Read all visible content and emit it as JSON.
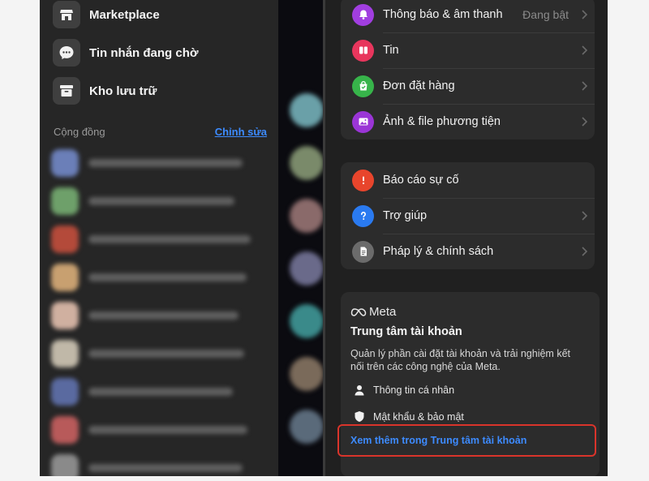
{
  "left_menu": {
    "items": [
      {
        "label": "Marketplace",
        "icon": "storefront-icon"
      },
      {
        "label": "Tin nhắn đang chờ",
        "icon": "chat-bubble-icon"
      },
      {
        "label": "Kho lưu trữ",
        "icon": "archive-box-icon"
      }
    ],
    "community": {
      "title": "Cộng đồng",
      "edit_label": "Chỉnh sửa"
    }
  },
  "settings": {
    "group1": [
      {
        "label": "Thông báo & âm thanh",
        "value": "Đang bật",
        "icon": "bell-icon",
        "color": "#a13ee0"
      },
      {
        "label": "Tin",
        "icon": "stories-icon",
        "color": "#e8365d"
      },
      {
        "label": "Đơn đặt hàng",
        "icon": "shopping-bag-icon",
        "color": "#37b44a"
      },
      {
        "label": "Ảnh & file phương tiện",
        "icon": "photo-icon",
        "color": "#9a35d6"
      }
    ],
    "group2": [
      {
        "label": "Báo cáo sự cố",
        "icon": "warning-icon",
        "color": "#e8452c"
      },
      {
        "label": "Trợ giúp",
        "icon": "help-icon",
        "color": "#2a7af0"
      },
      {
        "label": "Pháp lý & chính sách",
        "icon": "document-icon",
        "color": "#6b6b6b"
      }
    ]
  },
  "meta": {
    "brand": "Meta",
    "title": "Trung tâm tài khoản",
    "description": "Quản lý phần cài đặt tài khoản và trải nghiệm kết nối trên các công nghệ của Meta.",
    "items": [
      {
        "label": "Thông tin cá nhân",
        "icon": "person-icon"
      },
      {
        "label": "Mật khẩu & bảo mật",
        "icon": "shield-icon"
      }
    ],
    "see_more": "Xem thêm trong Trung tâm tài khoản"
  },
  "colors": {
    "accent": "#3d8bff",
    "highlight": "#d9342b"
  }
}
